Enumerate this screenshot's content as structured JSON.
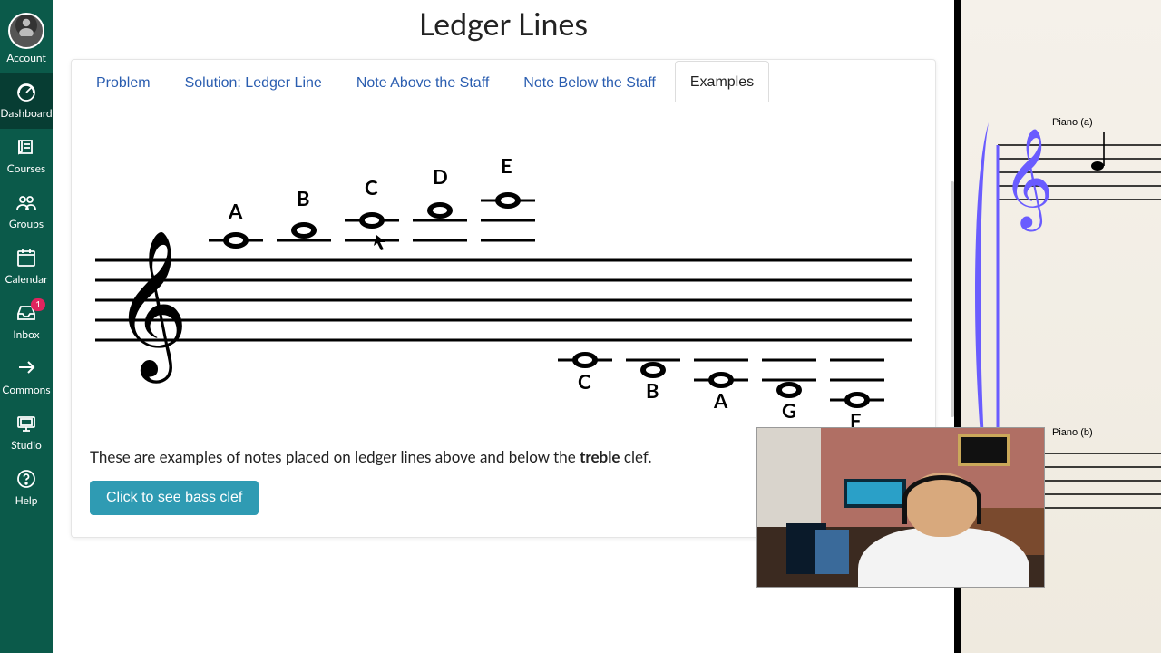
{
  "sidebar": {
    "items": [
      {
        "label": "Account",
        "icon": "avatar",
        "active": false
      },
      {
        "label": "Dashboard",
        "icon": "dashboard",
        "active": true
      },
      {
        "label": "Courses",
        "icon": "courses",
        "active": false
      },
      {
        "label": "Groups",
        "icon": "groups",
        "active": false
      },
      {
        "label": "Calendar",
        "icon": "calendar",
        "active": false
      },
      {
        "label": "Inbox",
        "icon": "inbox",
        "active": false,
        "badge": "1"
      },
      {
        "label": "Commons",
        "icon": "commons",
        "active": false
      },
      {
        "label": "Studio",
        "icon": "studio",
        "active": false
      },
      {
        "label": "Help",
        "icon": "help",
        "active": false
      }
    ]
  },
  "page": {
    "title": "Ledger Lines"
  },
  "tabs": [
    {
      "label": "Problem",
      "active": false
    },
    {
      "label": "Solution: Ledger Line",
      "active": false
    },
    {
      "label": "Note Above the Staff",
      "active": false
    },
    {
      "label": "Note Below the Staff",
      "active": false
    },
    {
      "label": "Examples",
      "active": true
    }
  ],
  "example": {
    "notes_above": [
      "A",
      "B",
      "C",
      "D",
      "E"
    ],
    "notes_below": [
      "C",
      "B",
      "A",
      "G",
      "F"
    ],
    "caption_pre": "These are examples of notes placed on ledger lines above and below the ",
    "caption_bold": "treble",
    "caption_post": " clef.",
    "button": "Click to see bass clef",
    "clef": "treble"
  },
  "right_panel": {
    "staves": [
      {
        "label": "Piano (a)",
        "clef": "treble"
      },
      {
        "label": "Piano (b)",
        "clef": "bass"
      }
    ],
    "accent_color": "#6a5cff"
  },
  "overlay": {
    "webcam_present": true
  }
}
